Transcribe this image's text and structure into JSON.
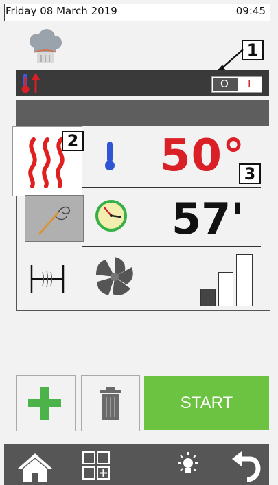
{
  "status_bar": {
    "date": "Friday 08 March 2019",
    "time": "09:45"
  },
  "header": {
    "chef_icon": "chef-hat-icon"
  },
  "heating_bar": {
    "icon": "thermometer-rising-icon",
    "toggle_off_label": "O",
    "toggle_on_label": "I",
    "toggle_state": "off"
  },
  "callouts": {
    "one": "1",
    "two": "2",
    "three": "3"
  },
  "cooking": {
    "mode_icon": "convection-heat-icon",
    "temperature_icon": "thermometer-icon",
    "temperature": "50°",
    "probe_icon": "core-probe-icon",
    "timer_icon": "clock-icon",
    "time": "57'",
    "humidity_icon": "humidity-damper-icon",
    "fan_icon": "fan-icon",
    "fan_speed_level": 1,
    "fan_speed_max": 3
  },
  "actions": {
    "add_icon": "plus-icon",
    "delete_icon": "trash-icon",
    "start_label": "START"
  },
  "nav": {
    "home_icon": "home-icon",
    "programs_icon": "grid-add-icon",
    "light_icon": "light-bulb-icon",
    "back_icon": "back-arrow-icon"
  },
  "colors": {
    "accent_green": "#6cc241",
    "temperature_red": "#d92027",
    "dark_bar": "#3a3a3a"
  }
}
